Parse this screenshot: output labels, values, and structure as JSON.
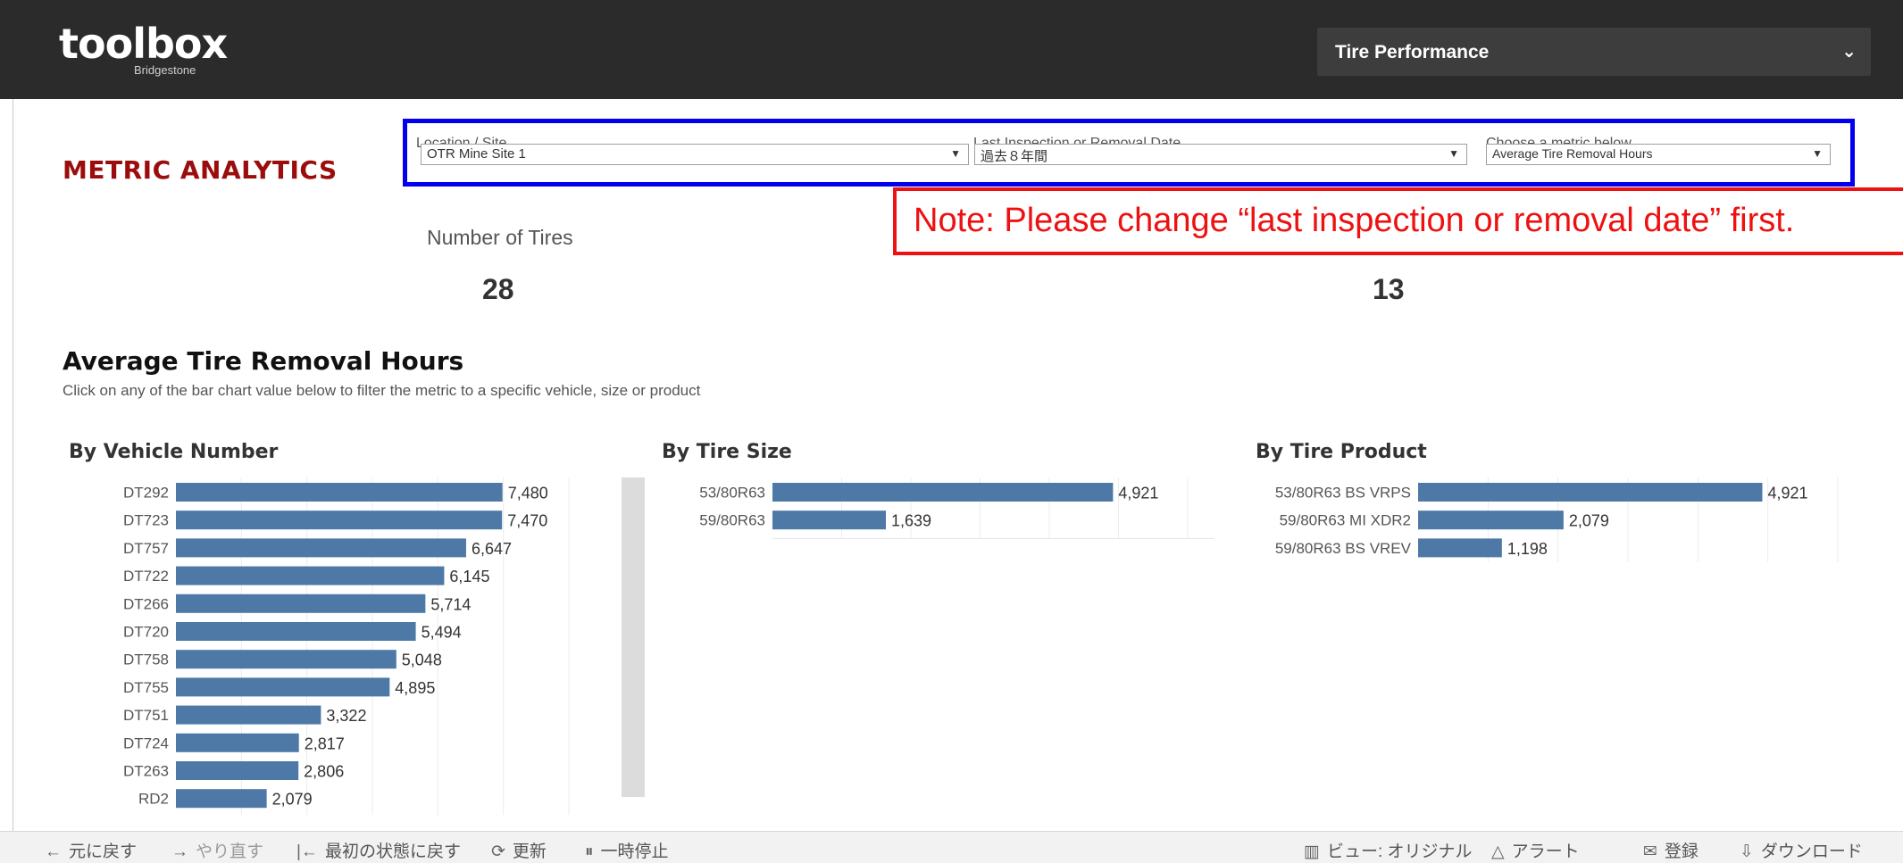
{
  "header": {
    "logo_text": "toolbox",
    "logo_sub": "Bridgestone",
    "app_select": "Tire Performance"
  },
  "page_title": "METRIC ANALYTICS",
  "filters": {
    "location": {
      "label": "Location / Site",
      "value": "OTR Mine Site 1"
    },
    "date": {
      "label": "Last Inspection or Removal Date",
      "value": "過去８年間"
    },
    "metric": {
      "label": "Choose a metric below",
      "value": "Average Tire Removal Hours"
    }
  },
  "note": "Note: Please change “last inspection or removal date” first.",
  "kpis": {
    "label": "Number of Tires",
    "value_left": "28",
    "value_right": "13"
  },
  "section": {
    "title": "Average Tire Removal Hours",
    "subtitle": "Click on any of the bar chart value below to filter the metric to a specific vehicle, size or product"
  },
  "colors": {
    "bar": "#4e79a7",
    "accent_red": "#9b0d0d",
    "filter_border": "#0000ee",
    "note_red": "#ee1111"
  },
  "chart_data": [
    {
      "type": "bar",
      "title": "By Vehicle Number",
      "orientation": "horizontal",
      "categories": [
        "DT292",
        "DT723",
        "DT757",
        "DT722",
        "DT266",
        "DT720",
        "DT758",
        "DT755",
        "DT751",
        "DT724",
        "DT263",
        "RD2"
      ],
      "values": [
        7480,
        7470,
        6647,
        6145,
        5714,
        5494,
        5048,
        4895,
        3322,
        2817,
        2806,
        2079
      ],
      "labels": [
        "7,480",
        "7,470",
        "6,647",
        "6,145",
        "5,714",
        "5,494",
        "5,048",
        "4,895",
        "3,322",
        "2,817",
        "2,806",
        "2,079"
      ],
      "xlim": [
        0,
        9000
      ],
      "grid": true
    },
    {
      "type": "bar",
      "title": "By Tire Size",
      "orientation": "horizontal",
      "categories": [
        "53/80R63",
        "59/80R63"
      ],
      "values": [
        4921,
        1639
      ],
      "labels": [
        "4,921",
        "1,639"
      ],
      "xlim": [
        0,
        6000
      ],
      "grid": true
    },
    {
      "type": "bar",
      "title": "By Tire Product",
      "orientation": "horizontal",
      "categories": [
        "53/80R63 BS VRPS",
        "59/80R63 MI XDR2",
        "59/80R63 BS VREV"
      ],
      "values": [
        4921,
        2079,
        1198
      ],
      "labels": [
        "4,921",
        "2,079",
        "1,198"
      ],
      "xlim": [
        0,
        6000
      ],
      "grid": true
    }
  ],
  "toolbar": {
    "undo": "元に戻す",
    "redo": "やり直す",
    "revert": "最初の状態に戻す",
    "refresh": "更新",
    "pause": "一時停止",
    "view": "ビュー: オリジナル",
    "alert": "アラート",
    "subscribe": "登録",
    "download": "ダウンロード"
  }
}
